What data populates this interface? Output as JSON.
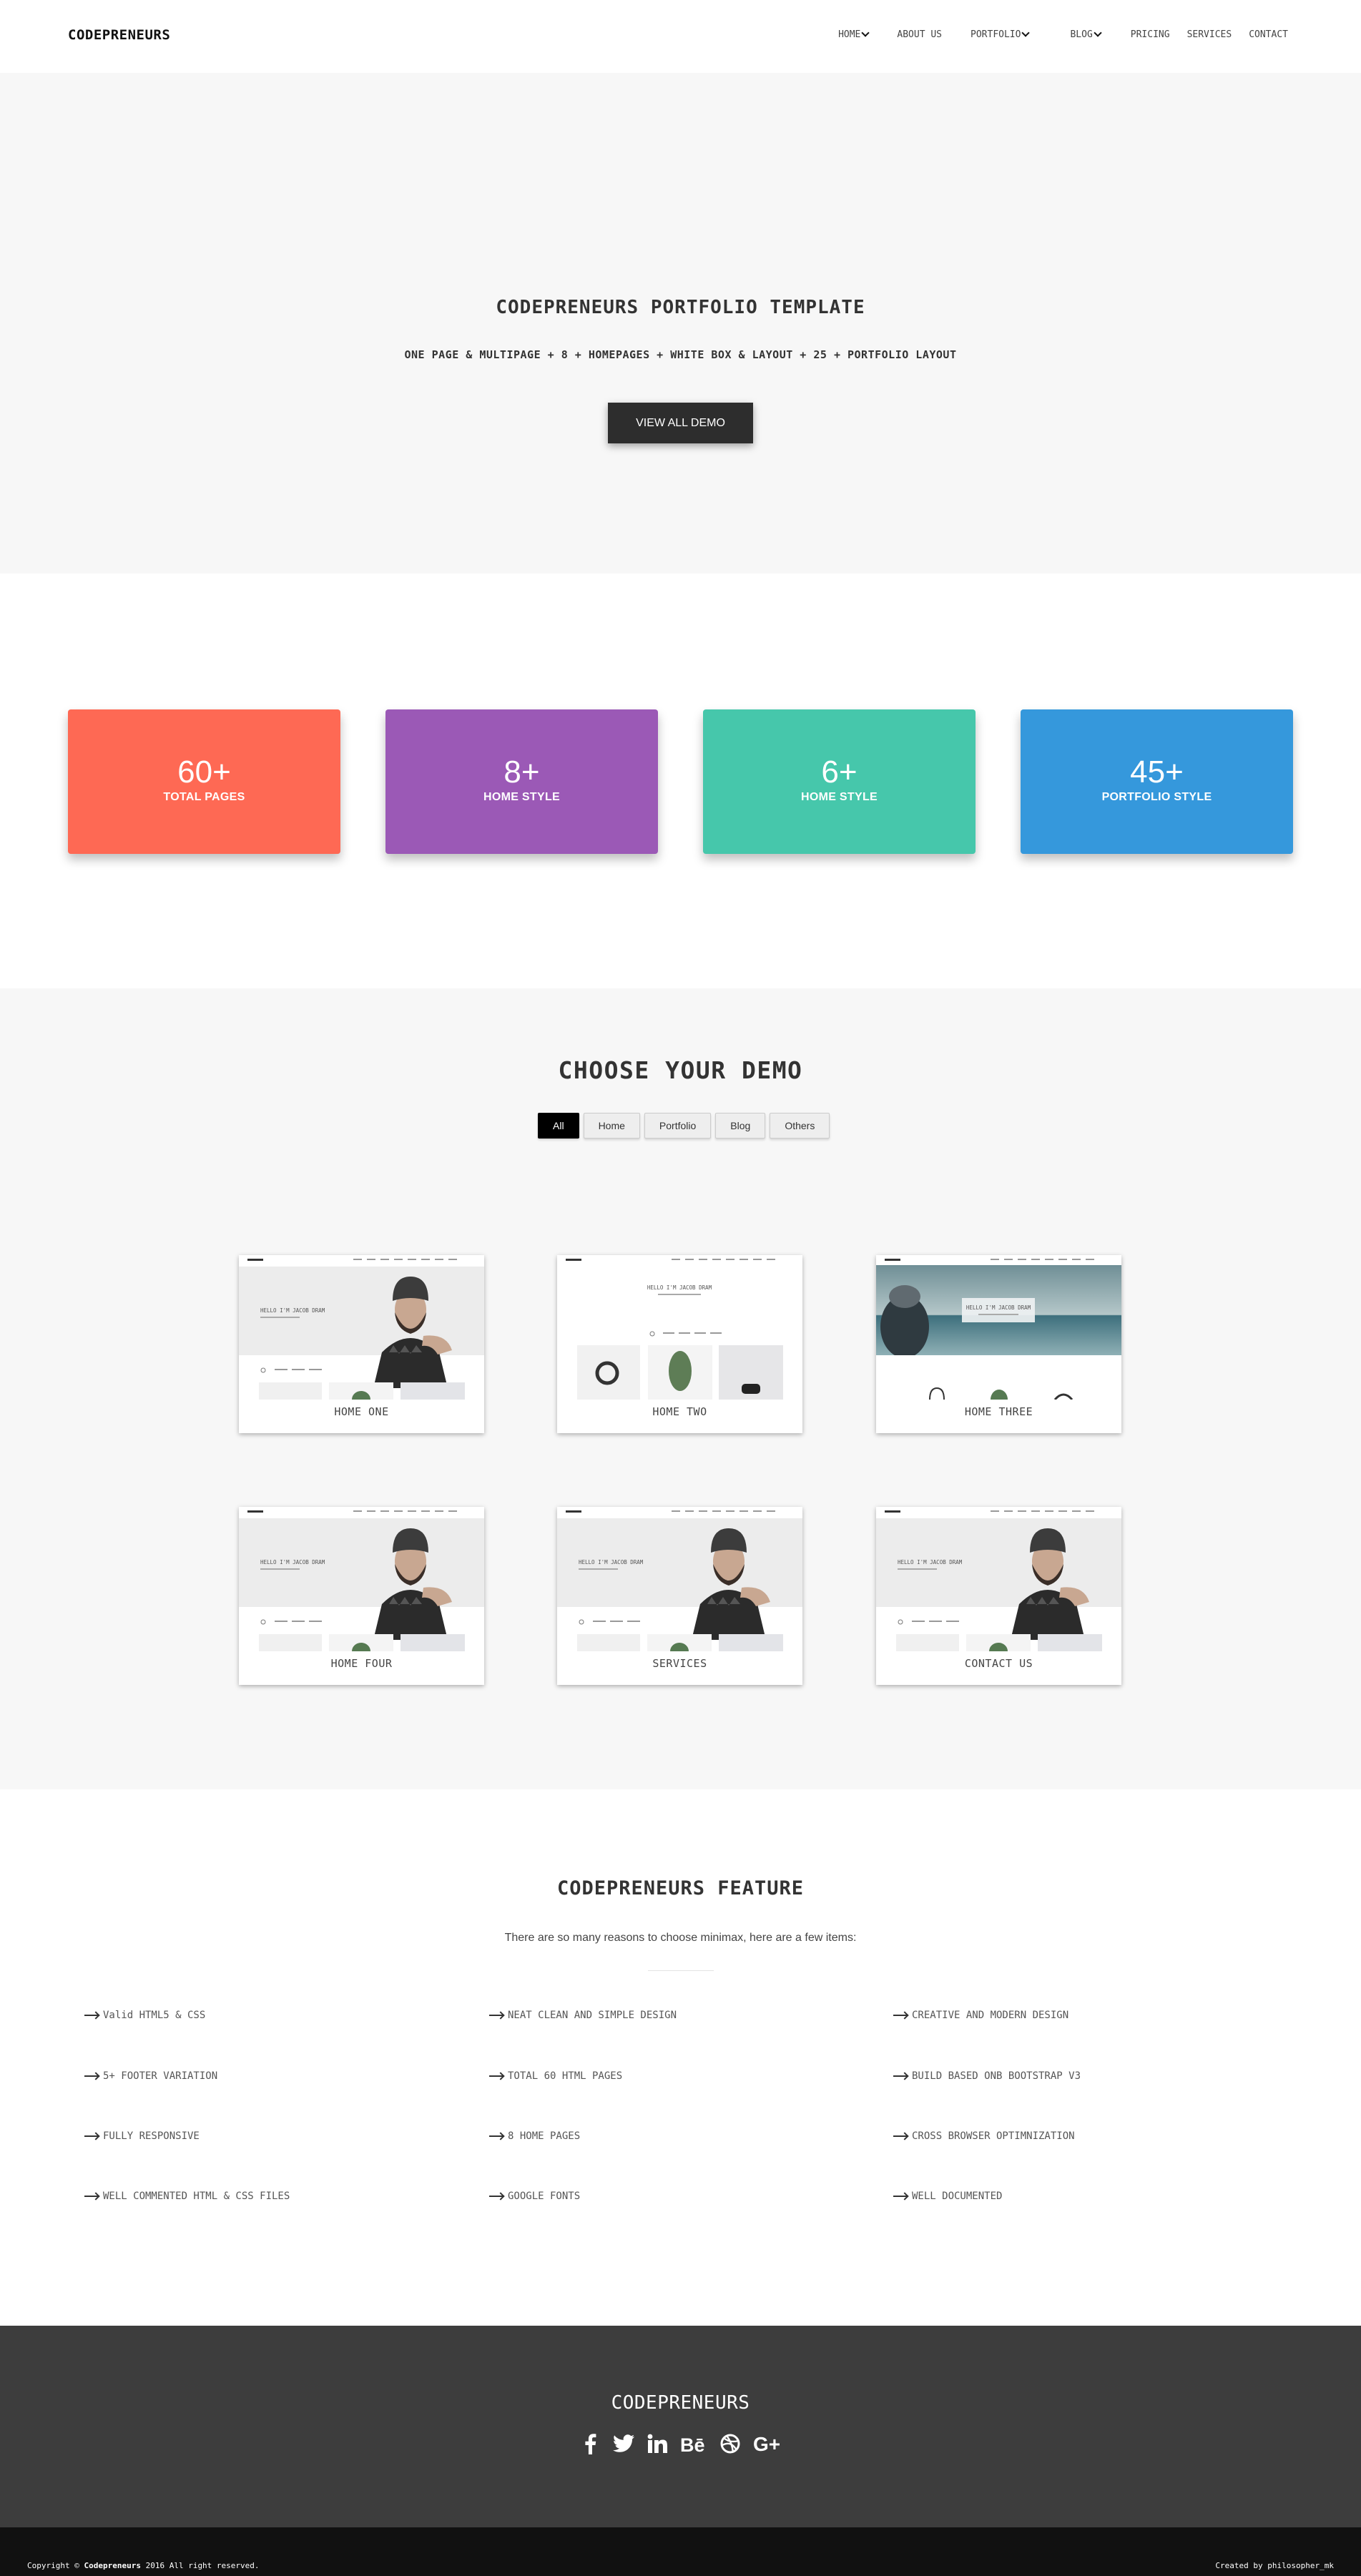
{
  "nav": {
    "brand": "CODEPRENEURS",
    "items": [
      {
        "label": "HOME",
        "dropdown": true
      },
      {
        "label": "ABOUT US",
        "dropdown": false
      },
      {
        "label": "PORTFOLIO",
        "dropdown": true
      },
      {
        "label": "BLOG",
        "dropdown": true
      },
      {
        "label": "PRICING",
        "dropdown": false
      },
      {
        "label": "SERVICES",
        "dropdown": false
      },
      {
        "label": "CONTACT",
        "dropdown": false
      }
    ]
  },
  "hero": {
    "title": "CODEPRENEURS PORTFOLIO TEMPLATE",
    "subtitle": "ONE PAGE & MULTIPAGE + 8 + HOMEPAGES + WHITE BOX & LAYOUT + 25 + PORTFOLIO LAYOUT",
    "button": "VIEW ALL DEMO"
  },
  "stats": [
    {
      "value": "60+",
      "label": "TOTAL PAGES",
      "color": "#fe6954"
    },
    {
      "value": "8+",
      "label": "HOME STYLE",
      "color": "#9b59b6"
    },
    {
      "value": "6+",
      "label": "HOME STYLE",
      "color": "#46c7ab"
    },
    {
      "value": "45+",
      "label": "PORTFOLIO STYLE",
      "color": "#3598dc"
    }
  ],
  "demo": {
    "title": "CHOOSE YOUR DEMO",
    "filters": [
      "All",
      "Home",
      "Portfolio",
      "Blog",
      "Others"
    ],
    "active_filter": "All",
    "cards": [
      {
        "caption": "HOME ONE",
        "variant": "split",
        "preview_heading": "HELLO I'M JACOB DRAM"
      },
      {
        "caption": "HOME TWO",
        "variant": "centered",
        "preview_heading": "HELLO I'M JACOB DRAM"
      },
      {
        "caption": "HOME THREE",
        "variant": "photo",
        "preview_heading": "HELLO I'M JACOB DRAM"
      },
      {
        "caption": "HOME FOUR",
        "variant": "split",
        "preview_heading": "HELLO I'M JACOB DRAM"
      },
      {
        "caption": "SERVICES",
        "variant": "split",
        "preview_heading": "HELLO I'M JACOB DRAM"
      },
      {
        "caption": "CONTACT US",
        "variant": "split",
        "preview_heading": "HELLO I'M JACOB DRAM"
      }
    ]
  },
  "features": {
    "title": "CODEPRENEURS FEATURE",
    "subtitle": "There are so many reasons to choose minimax, here are a few items:",
    "columns": [
      [
        "Valid HTML5 & CSS",
        "5+ FOOTER VARIATION",
        "FULLY RESPONSIVE",
        "WELL COMMENTED HTML & CSS FILES"
      ],
      [
        "NEAT CLEAN AND SIMPLE DESIGN",
        "TOTAL 60 HTML PAGES",
        "8 HOME PAGES",
        "GOOGLE FONTS"
      ],
      [
        "CREATIVE AND MODERN DESIGN",
        "BUILD BASED ONB BOOTSTRAP V3",
        "CROSS BROWSER OPTIMNIZATION",
        "WELL DOCUMENTED"
      ]
    ]
  },
  "footer": {
    "brand": "CODEPRENEURS",
    "socials": [
      "facebook-icon",
      "twitter-icon",
      "linkedin-icon",
      "behance-icon",
      "dribbble-icon",
      "google-plus-icon"
    ],
    "copyright_prefix": "Copyright © ",
    "copyright_brand": "Codepreneurs",
    "copyright_suffix": " 2016 All right reserved.",
    "credit": "Created by philosopher_mk"
  }
}
